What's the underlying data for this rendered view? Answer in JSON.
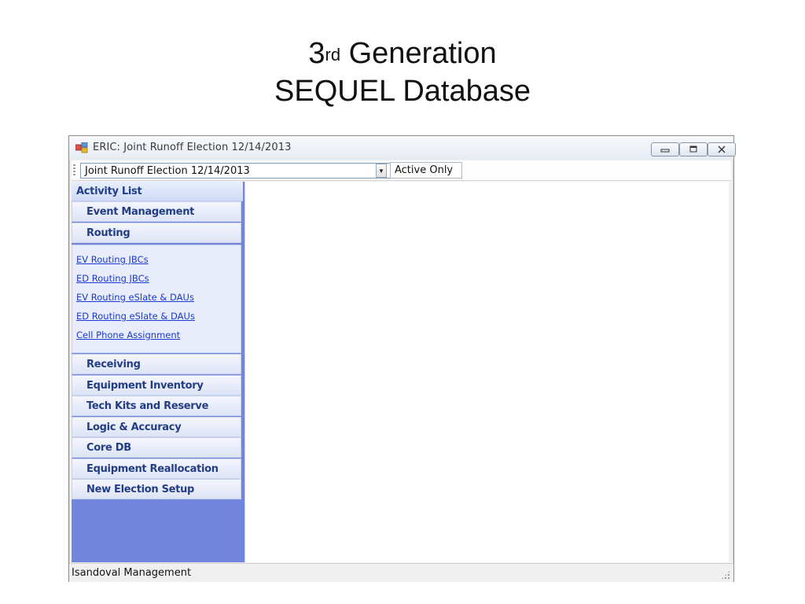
{
  "slide": {
    "title_num": "3",
    "title_sup": "rd",
    "title_rest": " Generation",
    "title_line2": "SEQUEL Database"
  },
  "window": {
    "title": "ERIC: Joint Runoff Election 12/14/2013",
    "icons": {
      "app": "app-icon",
      "minimize": "minimize-icon",
      "maximize": "maximize-icon",
      "close": "close-icon"
    }
  },
  "toolbar": {
    "election_select_value": "Joint Runoff Election 12/14/2013",
    "active_only_label": "Active Only"
  },
  "sidebar": {
    "header": "Activity List",
    "categories_top": [
      "Event Management",
      "Routing"
    ],
    "routing_links": [
      "EV Routing JBCs",
      "ED Routing JBCs",
      "EV Routing eSlate & DAUs",
      "ED Routing eSlate & DAUs",
      "Cell Phone Assignment"
    ],
    "categories_bottom": [
      "Receiving",
      "Equipment Inventory",
      "Tech Kits and Reserve",
      "Logic & Accuracy",
      "Core DB",
      "Equipment Reallocation",
      "New Election Setup"
    ]
  },
  "statusbar": {
    "text": "Isandoval  Management"
  },
  "colors": {
    "sidebar_bg": "#7085db",
    "link": "#1a3bd0",
    "category_text": "#233d85"
  }
}
